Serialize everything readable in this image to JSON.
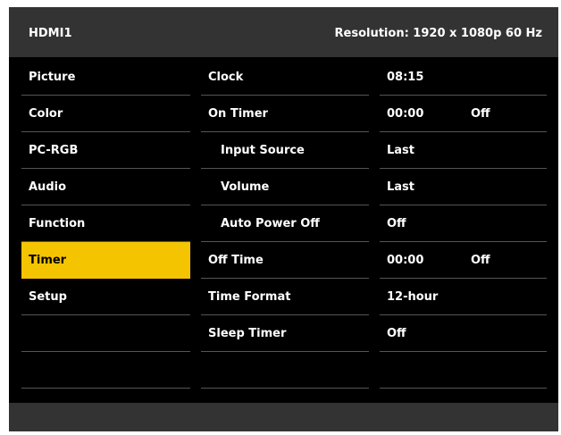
{
  "header": {
    "source": "HDMI1",
    "resolution": "Resolution: 1920 x 1080p 60 Hz"
  },
  "colors": {
    "background": "#000000",
    "bar": "#333333",
    "selected": "#f5c400",
    "divider": "#555555"
  },
  "categories": [
    {
      "label": "Picture",
      "selected": false
    },
    {
      "label": "Color",
      "selected": false
    },
    {
      "label": "PC-RGB",
      "selected": false
    },
    {
      "label": "Audio",
      "selected": false
    },
    {
      "label": "Function",
      "selected": false
    },
    {
      "label": "Timer",
      "selected": true
    },
    {
      "label": "Setup",
      "selected": false
    },
    {
      "label": "",
      "selected": false
    },
    {
      "label": "",
      "selected": false
    }
  ],
  "settings": [
    {
      "label": "Clock",
      "value": "08:15",
      "extra": ""
    },
    {
      "label": "On Timer",
      "value": "00:00",
      "extra": "Off"
    },
    {
      "label": "Input Source",
      "value": "Last",
      "extra": "",
      "indent": true
    },
    {
      "label": "Volume",
      "value": "Last",
      "extra": "",
      "indent": true
    },
    {
      "label": "Auto Power Off",
      "value": "Off",
      "extra": "",
      "indent": true
    },
    {
      "label": "Off Time",
      "value": "00:00",
      "extra": "Off"
    },
    {
      "label": "Time Format",
      "value": "12-hour",
      "extra": ""
    },
    {
      "label": "Sleep Timer",
      "value": "Off",
      "extra": ""
    },
    {
      "label": "",
      "value": "",
      "extra": ""
    }
  ]
}
